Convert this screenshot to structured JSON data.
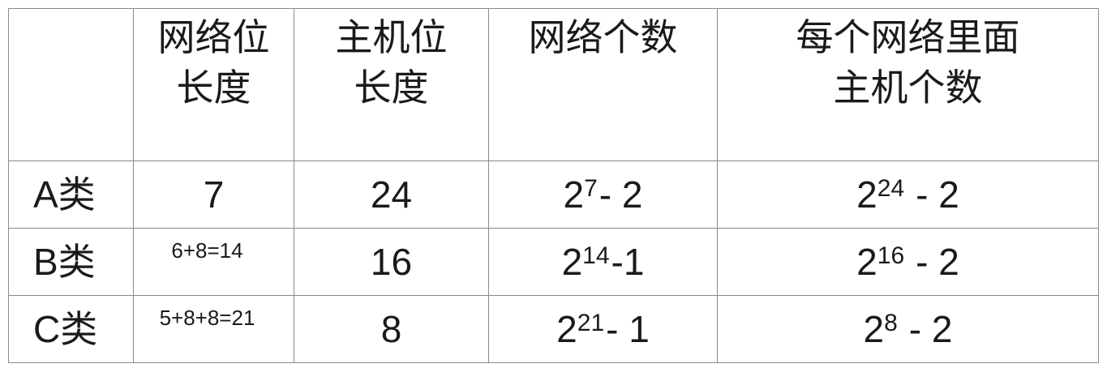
{
  "table": {
    "headers": [
      "",
      "网络位\n长度",
      "主机位\n长度",
      "网络个数",
      "每个网络里面\n主机个数"
    ],
    "header_lines": {
      "network_bits": [
        "网络位",
        "长度"
      ],
      "host_bits": [
        "主机位",
        "长度"
      ],
      "network_count": [
        "网络个数"
      ],
      "hosts_per_network": [
        "每个网络里面",
        "主机个数"
      ]
    },
    "rows": [
      {
        "label": "A类",
        "network_bits": "7",
        "host_bits": "24",
        "network_count": {
          "base": "2",
          "exp": "7",
          "suffix": "- 2"
        },
        "hosts_per_network": {
          "base": "2",
          "exp": "24",
          "suffix": "- 2"
        }
      },
      {
        "label": "B类",
        "network_bits": "6+8=14",
        "host_bits": "16",
        "network_count": {
          "base": "2",
          "exp": "14",
          "suffix": "-1"
        },
        "hosts_per_network": {
          "base": "2",
          "exp": "16",
          "suffix": "- 2"
        }
      },
      {
        "label": "C类",
        "network_bits": "5+8+8=21",
        "host_bits": "8",
        "network_count": {
          "base": "2",
          "exp": "21",
          "suffix": "- 1"
        },
        "hosts_per_network": {
          "base": "2",
          "exp": "8",
          "suffix": "- 2"
        }
      }
    ]
  }
}
